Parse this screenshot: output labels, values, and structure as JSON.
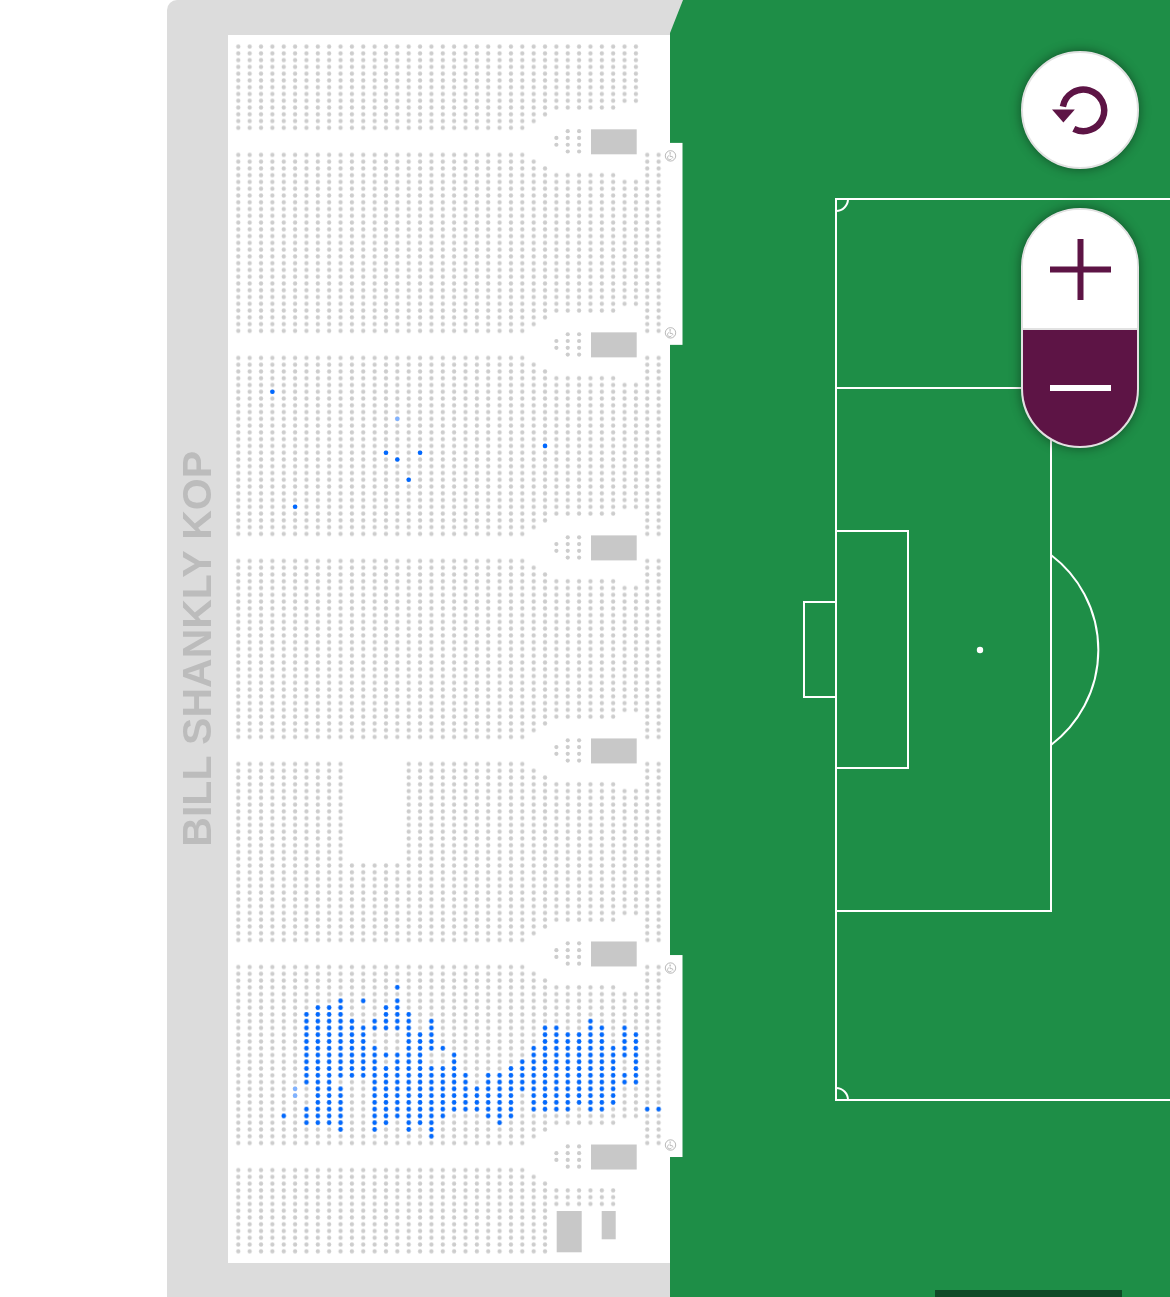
{
  "stand": {
    "name": "BILL SHANKLY KOP"
  },
  "seat_blocks": [
    {
      "kind": "upper",
      "available": false,
      "wheelchair_access": false
    },
    {
      "kind": "middle",
      "available": false,
      "wheelchair_access": true
    },
    {
      "kind": "middle",
      "available": true,
      "wheelchair_access": false
    },
    {
      "kind": "middle",
      "available": false,
      "wheelchair_access": false
    },
    {
      "kind": "middle_split",
      "available": false,
      "wheelchair_access": false
    },
    {
      "kind": "middle",
      "available": true,
      "wheelchair_access": true
    },
    {
      "kind": "lower",
      "available": false,
      "wheelchair_access": false
    }
  ],
  "map_controls": [
    {
      "kind": "reset"
    },
    {
      "kind": "zoom_in",
      "active": false
    },
    {
      "kind": "zoom_out",
      "active": true
    }
  ]
}
